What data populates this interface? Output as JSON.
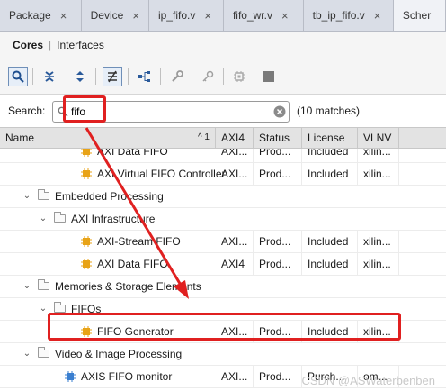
{
  "tabs": [
    {
      "label": "Package",
      "close": "×"
    },
    {
      "label": "Device",
      "close": "×"
    },
    {
      "label": "ip_fifo.v",
      "close": "×"
    },
    {
      "label": "fifo_wr.v",
      "close": "×"
    },
    {
      "label": "tb_ip_fifo.v",
      "close": "×"
    },
    {
      "label": "Scher"
    }
  ],
  "subtabs": {
    "cores": "Cores",
    "separator": "|",
    "interfaces": "Interfaces"
  },
  "toolbar_icons": [
    "search-icon",
    "collapse-all-icon",
    "expand-all-icon",
    "filter-icon",
    "hierarchy-icon",
    "wrench-icon",
    "key-icon",
    "chip-icon",
    "stop-icon"
  ],
  "search": {
    "label": "Search:",
    "value": "fifo",
    "matches": "(10 matches)"
  },
  "columns": {
    "name": "Name",
    "sort": "^ 1",
    "axi4": "AXI4",
    "status": "Status",
    "license": "License",
    "vlnv": "VLNV"
  },
  "rows": [
    {
      "name": "AXI Data FIFO",
      "level": 3,
      "kind": "ip",
      "axi4": "AXI...",
      "status": "Prod...",
      "license": "Included",
      "vlnv": "xilin..."
    },
    {
      "name": "AXI Virtual FIFO Controller",
      "level": 3,
      "kind": "ip",
      "axi4": "AXI...",
      "status": "Prod...",
      "license": "Included",
      "vlnv": "xilin..."
    },
    {
      "name": "Embedded Processing",
      "level": 1,
      "kind": "folder"
    },
    {
      "name": "AXI Infrastructure",
      "level": 2,
      "kind": "folder"
    },
    {
      "name": "AXI-Stream FIFO",
      "level": 3,
      "kind": "ip",
      "axi4": "AXI...",
      "status": "Prod...",
      "license": "Included",
      "vlnv": "xilin..."
    },
    {
      "name": "AXI Data FIFO",
      "level": 3,
      "kind": "ip",
      "axi4": "AXI4",
      "status": "Prod...",
      "license": "Included",
      "vlnv": "xilin..."
    },
    {
      "name": "Memories & Storage Elements",
      "level": 1,
      "kind": "folder"
    },
    {
      "name": "FIFOs",
      "level": 2,
      "kind": "folder"
    },
    {
      "name": "FIFO Generator",
      "level": 3,
      "kind": "ip",
      "axi4": "AXI...",
      "status": "Prod...",
      "license": "Included",
      "vlnv": "xilin..."
    },
    {
      "name": "Video & Image Processing",
      "level": 1,
      "kind": "folder"
    },
    {
      "name": "AXIS FIFO monitor",
      "level": 2,
      "kind": "ip-blue",
      "axi4": "AXI...",
      "status": "Prod...",
      "license": "Purch...",
      "vlnv": "om..."
    }
  ],
  "chevron": "⌄",
  "watermark": "CSDN @ASWaterbenben",
  "colors": {
    "highlight": "#e02020",
    "ip_icon": "#e8a317",
    "ip_icon_blue": "#3a7fd0"
  }
}
